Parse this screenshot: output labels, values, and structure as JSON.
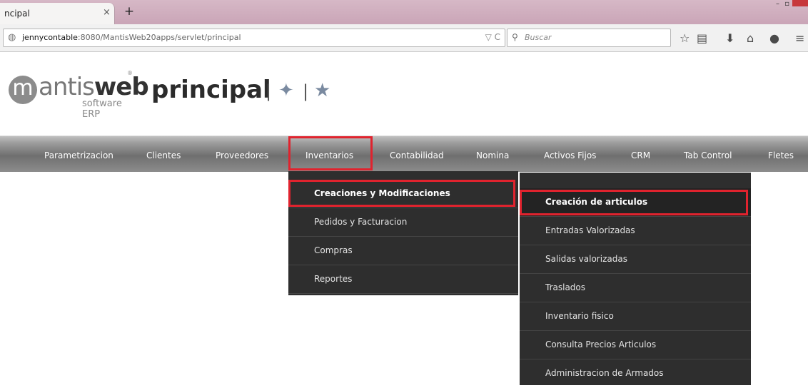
{
  "browser": {
    "tab_title": "ncipal",
    "tab_close": "×",
    "new_tab": "+",
    "url_host": "jennycontable",
    "url_path": ":8080/MantisWeb20apps/servlet/principal",
    "url_icons": "▽ C",
    "search_placeholder": "Buscar",
    "toolbar_icons": [
      "star-icon",
      "reading-list-icon",
      "download-icon",
      "home-icon",
      "chat-icon",
      "menu-icon"
    ]
  },
  "header": {
    "logo_letter": "m",
    "logo_word_light": "antis",
    "logo_word_bold": "web",
    "logo_reg": "®",
    "logo_sub": "software ERP",
    "page_title": "principal",
    "separator": "|"
  },
  "menu": {
    "items": [
      "Parametrizacion",
      "Clientes",
      "Proveedores",
      "Inventarios",
      "Contabilidad",
      "Nomina",
      "Activos Fijos",
      "CRM",
      "Tab Control",
      "Fletes"
    ],
    "highlighted": "Inventarios"
  },
  "submenu": {
    "items": [
      "Creaciones y Modificaciones",
      "Pedidos y Facturacion",
      "Compras",
      "Reportes"
    ],
    "active": "Creaciones y Modificaciones"
  },
  "subsubmenu": {
    "items": [
      "Creación de articulos",
      "Entradas Valorizadas",
      "Salidas valorizadas",
      "Traslados",
      "Inventario fisico",
      "Consulta Precios Articulos",
      "Administracion de Armados"
    ],
    "active": "Creación de articulos"
  },
  "colors": {
    "highlight": "#e0232e",
    "dropdown_bg": "#2e2e2e",
    "tabbar": "#caa5b7"
  }
}
